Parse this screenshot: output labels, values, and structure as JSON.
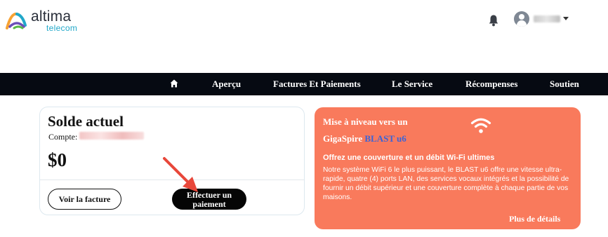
{
  "brand": {
    "name": "altima",
    "subtitle": "telecom",
    "colors": {
      "arc_orange": "#f7a233",
      "arc_teal": "#21a8c9",
      "arc_purple": "#6b4fb8",
      "arc_green": "#58b947"
    }
  },
  "header": {
    "notification_icon": "bell-icon",
    "user_icon": "user-avatar-icon",
    "menu_icon": "caret-down-icon"
  },
  "nav": {
    "home_icon": "home-icon",
    "items": [
      {
        "label": "Aperçu"
      },
      {
        "label": "Factures Et Paiements"
      },
      {
        "label": "Le Service"
      },
      {
        "label": "Récompenses"
      },
      {
        "label": "Soutien"
      }
    ]
  },
  "balance": {
    "title": "Solde actuel",
    "account_label": "Compte:",
    "amount": "$0",
    "view_invoice_label": "Voir la facture",
    "pay_label_line1": "Effectuer un",
    "pay_label_line2": "paiement"
  },
  "promo": {
    "line1": "Mise à niveau vers un",
    "line2_prefix": "GigaSpire ",
    "line2_product": "BLAST u6",
    "headline": "Offrez une couverture et un débit Wi-Fi ultimes",
    "body": "Notre système WiFi 6 le plus puissant, le BLAST u6 offre une vitesse ultra-rapide, quatre (4) ports LAN, des services vocaux intégrés et la possibilité de fournir un débit supérieur et une couverture complète à chaque partie de vos maisons.",
    "more_label": "Plus de détails",
    "icon": "wifi-icon",
    "colors": {
      "background": "#f97a5c",
      "product": "#3b63d8"
    }
  },
  "annotation": {
    "icon": "red-arrow-icon",
    "color": "#e8473a"
  }
}
